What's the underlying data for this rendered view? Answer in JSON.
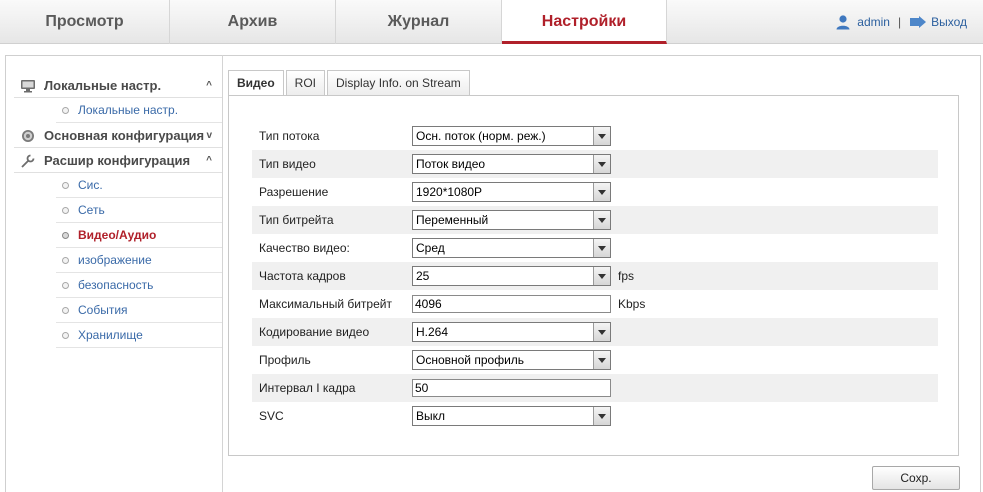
{
  "topnav": {
    "tabs": [
      {
        "label": "Просмотр",
        "active": false
      },
      {
        "label": "Архив",
        "active": false
      },
      {
        "label": "Журнал",
        "active": false
      },
      {
        "label": "Настройки",
        "active": true
      }
    ],
    "user": "admin",
    "separator": "|",
    "logout": "Выход"
  },
  "sidebar": {
    "groups": [
      {
        "label": "Локальные настр.",
        "chevron": "^",
        "icon": "monitor-icon",
        "items": [
          "Локальные настр."
        ]
      },
      {
        "label": "Основная конфигурация",
        "chevron": "v",
        "icon": "gear-icon",
        "items": []
      },
      {
        "label": "Расшир конфигурация",
        "chevron": "^",
        "icon": "wrench-icon",
        "items": [
          "Сис.",
          "Сеть",
          "Видео/Аудио",
          "изображение",
          "безопасность",
          "События",
          "Хранилище"
        ],
        "active_item": "Видео/Аудио"
      }
    ]
  },
  "subtabs": [
    "Видео",
    "ROI",
    "Display Info. on Stream"
  ],
  "active_subtab": "Видео",
  "form": {
    "rows": [
      {
        "label": "Тип потока",
        "type": "select",
        "value": "Осн. поток (норм. реж.)"
      },
      {
        "label": "Тип видео",
        "type": "select",
        "value": "Поток видео"
      },
      {
        "label": "Разрешение",
        "type": "select",
        "value": "1920*1080P"
      },
      {
        "label": "Тип битрейта",
        "type": "select",
        "value": "Переменный"
      },
      {
        "label": "Качество видео:",
        "type": "select",
        "value": "Сред"
      },
      {
        "label": "Частота кадров",
        "type": "select",
        "value": "25",
        "unit": "fps"
      },
      {
        "label": "Максимальный битрейт",
        "type": "text",
        "value": "4096",
        "unit": "Kbps"
      },
      {
        "label": "Кодирование видео",
        "type": "select",
        "value": "H.264"
      },
      {
        "label": "Профиль",
        "type": "select",
        "value": "Основной профиль"
      },
      {
        "label": "Интервал I кадра",
        "type": "text",
        "value": "50"
      },
      {
        "label": "SVC",
        "type": "select",
        "value": "Выкл"
      }
    ]
  },
  "save_label": "Сохр.",
  "colors": {
    "accent": "#b0202a",
    "link": "#3a6aa8"
  }
}
